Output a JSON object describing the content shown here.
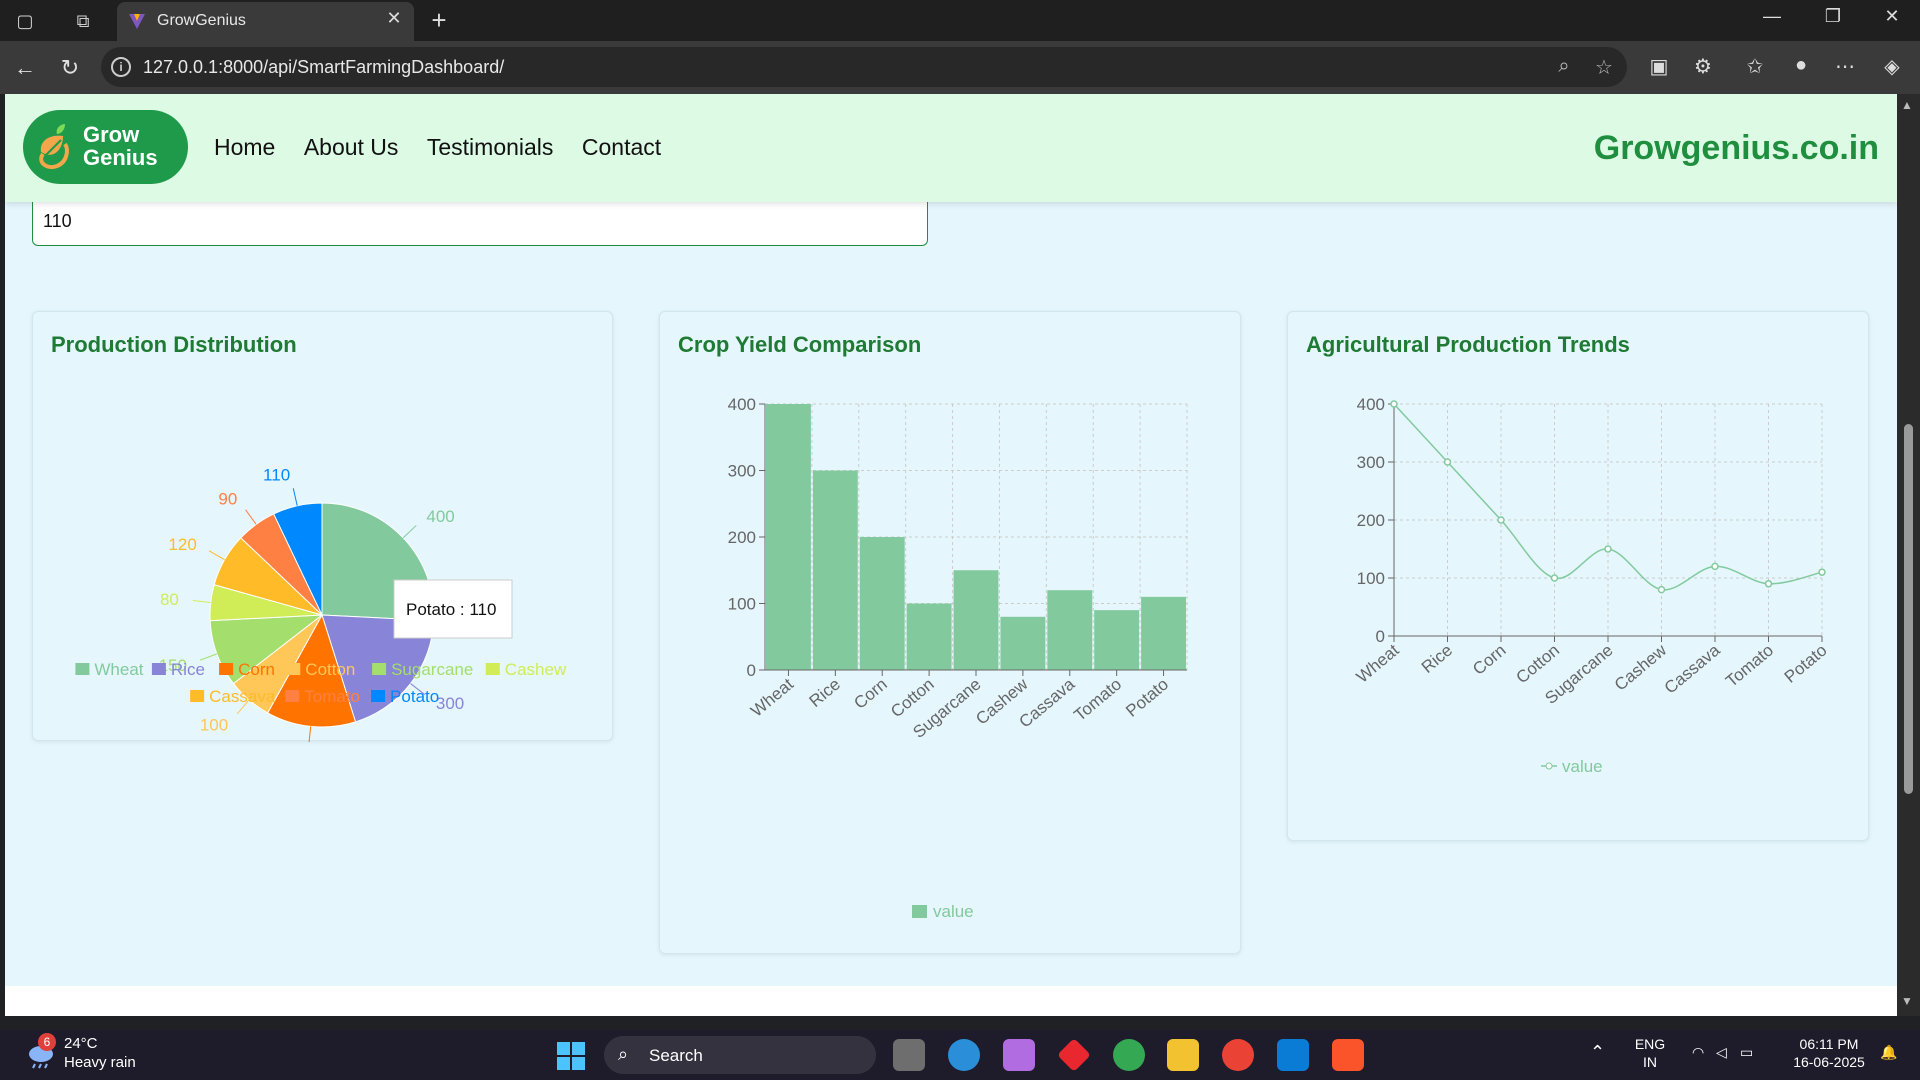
{
  "browser": {
    "tab_title": "GrowGenius",
    "url": "127.0.0.1:8000/api/SmartFarmingDashboard/"
  },
  "header": {
    "logo_line1": "Grow",
    "logo_line2": "Genius",
    "nav": [
      "Home",
      "About Us",
      "Testimonials",
      "Contact"
    ],
    "brand": "Growgenius.co.in"
  },
  "input_value": "110",
  "cards": {
    "pie_title": "Production Distribution",
    "bar_title": "Crop Yield Comparison",
    "line_title": "Agricultural Production Trends"
  },
  "chart_data": [
    {
      "type": "pie",
      "title": "Production Distribution",
      "categories": [
        "Wheat",
        "Rice",
        "Corn",
        "Cotton",
        "Sugarcane",
        "Cashew",
        "Cassava",
        "Tomato",
        "Potato"
      ],
      "values": [
        400,
        300,
        200,
        100,
        150,
        80,
        120,
        90,
        110
      ],
      "colors": [
        "#82ca9d",
        "#8884d8",
        "#ff7300",
        "#ffc658",
        "#a4de6c",
        "#d0ed57",
        "#ffbb28",
        "#ff8042",
        "#0088fe"
      ],
      "legend": "bottom",
      "tooltip": "Potato : 110"
    },
    {
      "type": "bar",
      "title": "Crop Yield Comparison",
      "categories": [
        "Wheat",
        "Rice",
        "Corn",
        "Cotton",
        "Sugarcane",
        "Cashew",
        "Cassava",
        "Tomato",
        "Potato"
      ],
      "series": [
        {
          "name": "value",
          "values": [
            400,
            300,
            200,
            100,
            150,
            80,
            120,
            90,
            110
          ]
        }
      ],
      "yticks": [
        0,
        100,
        200,
        300,
        400
      ],
      "ylim": [
        0,
        400
      ],
      "color": "#82ca9d",
      "grid": true,
      "legend": "bottom"
    },
    {
      "type": "line",
      "title": "Agricultural Production Trends",
      "categories": [
        "Wheat",
        "Rice",
        "Corn",
        "Cotton",
        "Sugarcane",
        "Cashew",
        "Cassava",
        "Tomato",
        "Potato"
      ],
      "series": [
        {
          "name": "value",
          "values": [
            400,
            300,
            200,
            100,
            150,
            80,
            120,
            90,
            110
          ]
        }
      ],
      "yticks": [
        0,
        100,
        200,
        300,
        400
      ],
      "ylim": [
        0,
        400
      ],
      "color": "#82ca9d",
      "grid": true,
      "legend": "bottom"
    }
  ],
  "taskbar": {
    "badge": "6",
    "temp": "24°C",
    "weather": "Heavy rain",
    "search": "Search",
    "lang1": "ENG",
    "lang2": "IN",
    "time": "06:11 PM",
    "date": "16-06-2025"
  }
}
